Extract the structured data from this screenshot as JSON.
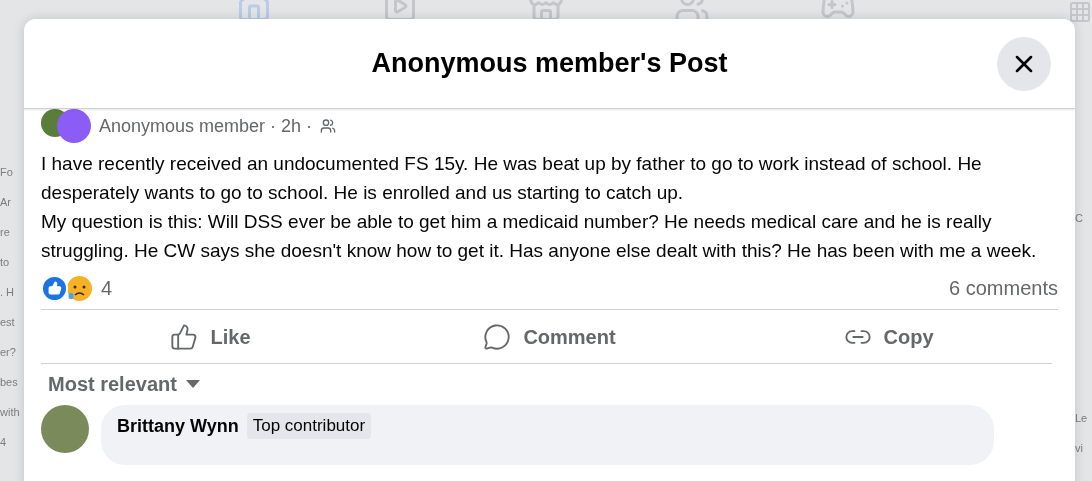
{
  "background": {
    "left_fragments": [
      "Fo",
      "Ar",
      "re",
      "to",
      ". H",
      "est",
      "er?",
      "bes",
      "with",
      "4"
    ],
    "right_fragments": [
      "C",
      "Le",
      "vi"
    ]
  },
  "dialog": {
    "title": "Anonymous member's Post"
  },
  "post": {
    "author": "Anonymous member · 2h ·",
    "body": [
      "I have recently received an undocumented FS 15y. He was beat up by father to go to work instead of school. He desperately wants to go to school. He is enrolled and us starting to catch up.",
      "My question is this: Will DSS ever be able to get him a medicaid number? He needs medical care and he is really struggling. He CW says she doesn't know how to get it. Has anyone else dealt with this? He has been with me a week."
    ],
    "reactions": {
      "count": "4"
    },
    "comments_count": "6 comments",
    "actions": [
      {
        "kind": "like",
        "label": "Like"
      },
      {
        "kind": "comment",
        "label": "Comment"
      },
      {
        "kind": "copy",
        "label": "Copy"
      }
    ]
  },
  "comments": {
    "sort": "Most relevant",
    "items": [
      {
        "author": "Brittany Wynn",
        "badge": "Top contributor"
      }
    ]
  }
}
